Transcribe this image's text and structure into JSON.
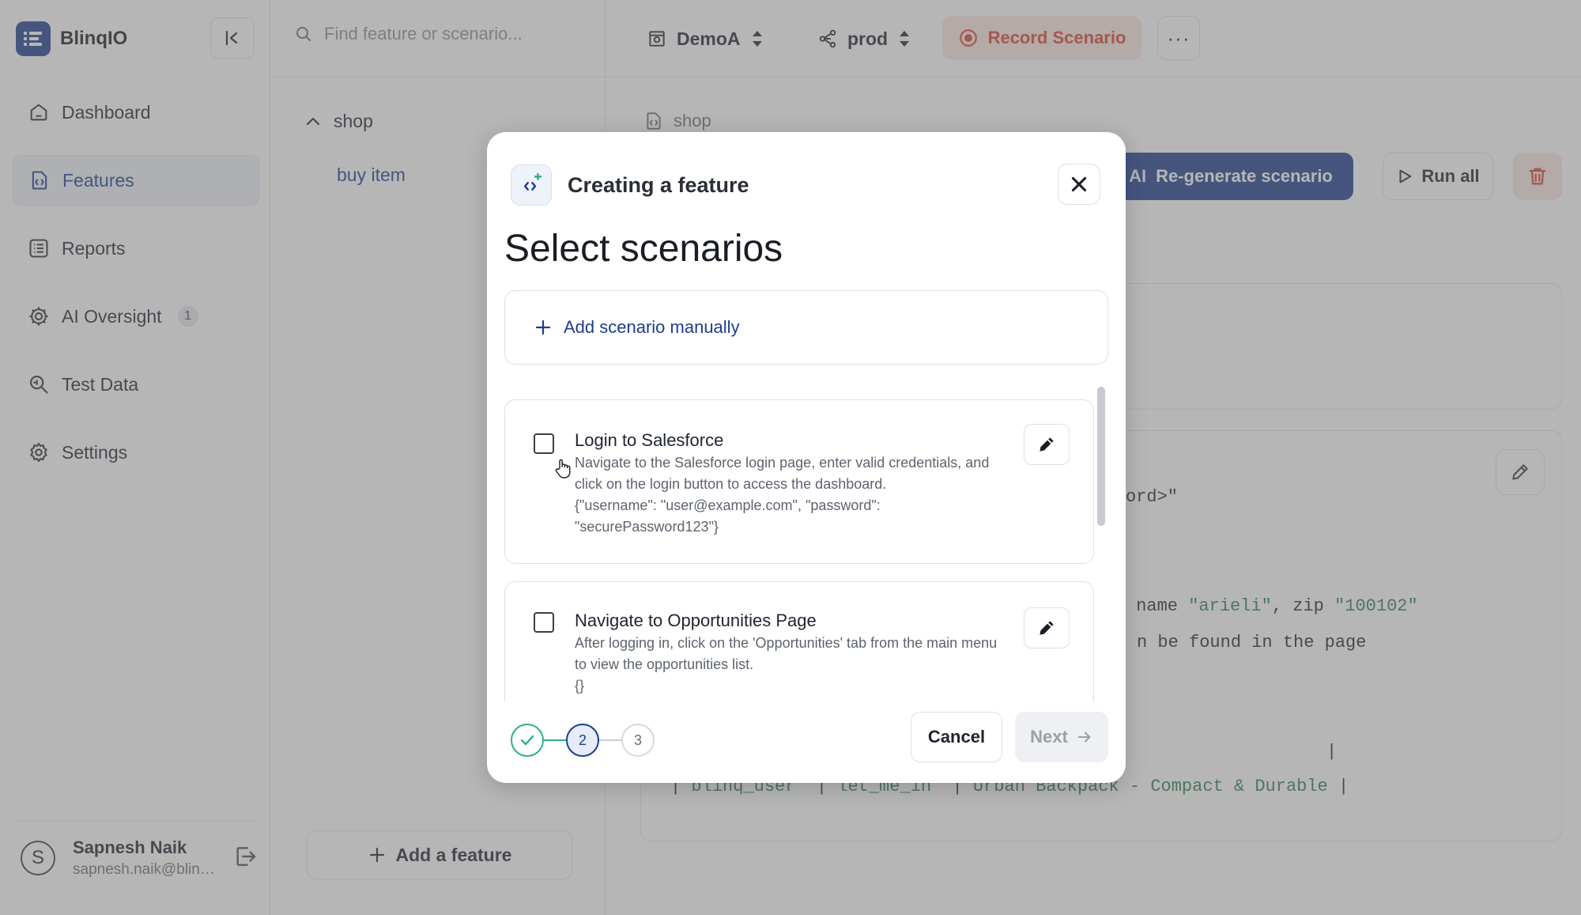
{
  "app": {
    "name": "BlinqIO"
  },
  "sidebar": {
    "items": [
      {
        "label": "Dashboard",
        "icon": "home-icon"
      },
      {
        "label": "Features",
        "icon": "feature-file-icon",
        "active": true
      },
      {
        "label": "Reports",
        "icon": "list-icon"
      },
      {
        "label": "AI Oversight",
        "icon": "ai-gear-icon",
        "badge": "1"
      },
      {
        "label": "Test Data",
        "icon": "data-search-icon"
      },
      {
        "label": "Settings",
        "icon": "gear-icon"
      }
    ],
    "user": {
      "initial": "S",
      "name": "Sapnesh Naik",
      "email": "sapnesh.naik@blinq.io"
    }
  },
  "topbar": {
    "search_placeholder": "Find feature or scenario...",
    "project": "DemoA",
    "environment": "prod",
    "record_label": "Record Scenario",
    "more_label": "···"
  },
  "tree": {
    "group": "shop",
    "item": "buy item",
    "add_label": "Add a feature"
  },
  "content": {
    "breadcrumb": "shop",
    "regen_ai": "AI",
    "regen_label": "Re-generate scenario",
    "run_all_label": "Run all",
    "code_line_1": "ord>\"",
    "code_line_2_pre": " name ",
    "code_line_2_name": "\"arieli\"",
    "code_line_2_mid": ", zip ",
    "code_line_2_zip": "\"100102\"",
    "code_line_3": "n be found in the page",
    "code_line_4": "|",
    "code_line_5_pipe1": "| ",
    "code_line_5_user": "blinq_user",
    "code_line_5_pipe2": "  | ",
    "code_line_5_pass": "let_me_in",
    "code_line_5_pipe3": "  | ",
    "code_line_5_item": "Urban Backpack - Compact & Durable",
    "code_line_5_pipe4": " |"
  },
  "modal": {
    "title": "Creating a feature",
    "heading": "Select scenarios",
    "add_manual_label": "Add scenario manually",
    "scenarios": [
      {
        "title": "Login to Salesforce",
        "description": "Navigate to the Salesforce login page, enter valid credentials, and click on the login button to access the dashboard.",
        "params": "{\"username\": \"user@example.com\", \"password\": \"securePassword123\"}",
        "checked": false
      },
      {
        "title": "Navigate to Opportunities Page",
        "description": "After logging in, click on the 'Opportunities' tab from the main menu to view the opportunities list.",
        "params": "{}",
        "checked": false
      }
    ],
    "steps": [
      {
        "label": "",
        "state": "done"
      },
      {
        "label": "2",
        "state": "current"
      },
      {
        "label": "3",
        "state": "todo"
      }
    ],
    "cancel_label": "Cancel",
    "next_label": "Next"
  },
  "colors": {
    "brand": "#1d3d8f",
    "danger": "#d6452f",
    "success": "#2fae8f"
  }
}
